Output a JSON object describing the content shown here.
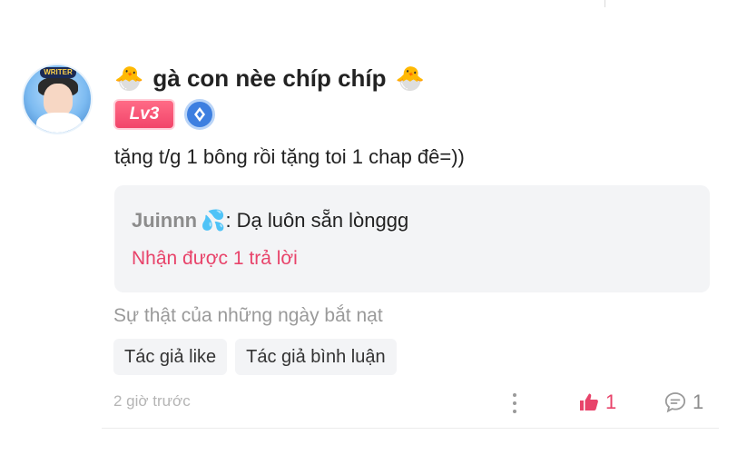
{
  "comment": {
    "username": "gà con nèe chíp chíp",
    "name_emoji": "🐣",
    "avatar_tag": "WRITER",
    "level_badge": "Lv3",
    "text": "tặng t/g 1 bông rồi tặng toi 1 chap đê=))",
    "reply_preview": {
      "user": "Juinnn",
      "user_emoji": "💦",
      "colon": ":",
      "text": "Dạ luôn sẵn lònggg",
      "count_label": "Nhận được 1 trả lời"
    },
    "story_title": "Sự thật của những ngày bắt nạt",
    "tags": [
      "Tác giả like",
      "Tác giả bình luận"
    ],
    "time": "2 giờ trước",
    "like_count": "1",
    "reply_count": "1"
  },
  "colors": {
    "accent": "#e8436a",
    "level_badge_bg": "#f2456a",
    "rank_badge_bg": "#3d7fe0",
    "box_bg": "#f3f4f6",
    "muted_text": "#9a9a9a"
  },
  "icons": [
    "hatching-chick-emoji",
    "rank-badge-icon",
    "droplets-emoji",
    "more-vertical-icon",
    "thumbs-up-icon",
    "comment-bubble-icon"
  ]
}
